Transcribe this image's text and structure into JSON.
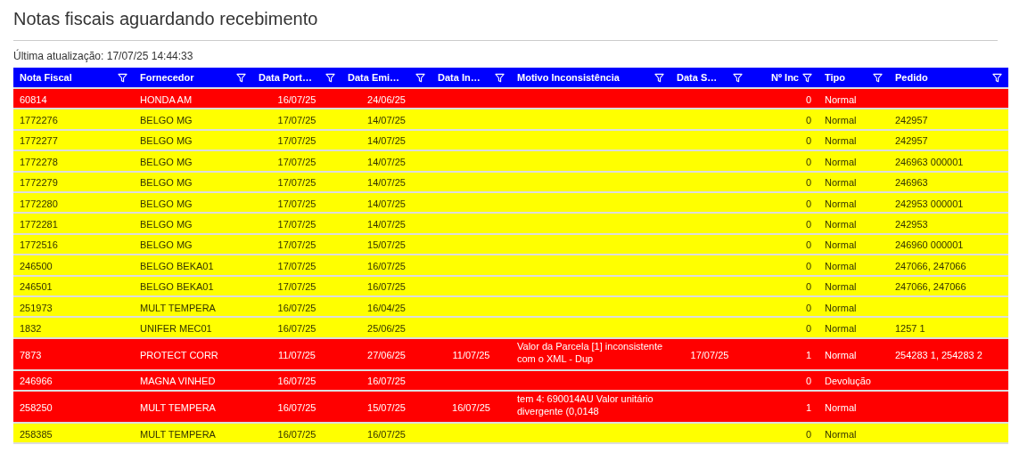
{
  "title": "Notas fiscais aguardando recebimento",
  "last_update": "Última atualização: 17/07/25 14:44:33",
  "table": {
    "columns": [
      "Nota Fiscal",
      "Fornecedor",
      "Data Port…",
      "Data Emi…",
      "Data In…",
      "Motivo Inconsistência",
      "Data S…",
      "Nº Inc",
      "Tipo",
      "Pedido"
    ],
    "rows": [
      {
        "color": "#ff0000",
        "nota_fiscal": "60814",
        "fornecedor": "HONDA AM",
        "data_port": "16/07/25",
        "data_emi": "24/06/25",
        "n_inc": "0",
        "tipo": "Normal"
      },
      {
        "color": "#ffff00",
        "nota_fiscal": "1772276",
        "fornecedor": "BELGO MG",
        "data_port": "17/07/25",
        "data_emi": "14/07/25",
        "n_inc": "0",
        "tipo": "Normal",
        "pedido": "242957"
      },
      {
        "color": "#ffff00",
        "nota_fiscal": "1772277",
        "fornecedor": "BELGO MG",
        "data_port": "17/07/25",
        "data_emi": "14/07/25",
        "n_inc": "0",
        "tipo": "Normal",
        "pedido": "242957"
      },
      {
        "color": "#ffff00",
        "nota_fiscal": "1772278",
        "fornecedor": "BELGO MG",
        "data_port": "17/07/25",
        "data_emi": "14/07/25",
        "n_inc": "0",
        "tipo": "Normal",
        "pedido": "246963 000001"
      },
      {
        "color": "#ffff00",
        "nota_fiscal": "1772279",
        "fornecedor": "BELGO MG",
        "data_port": "17/07/25",
        "data_emi": "14/07/25",
        "n_inc": "0",
        "tipo": "Normal",
        "pedido": "246963"
      },
      {
        "color": "#ffff00",
        "nota_fiscal": "1772280",
        "fornecedor": "BELGO MG",
        "data_port": "17/07/25",
        "data_emi": "14/07/25",
        "n_inc": "0",
        "tipo": "Normal",
        "pedido": "242953 000001"
      },
      {
        "color": "#ffff00",
        "nota_fiscal": "1772281",
        "fornecedor": "BELGO MG",
        "data_port": "17/07/25",
        "data_emi": "14/07/25",
        "n_inc": "0",
        "tipo": "Normal",
        "pedido": "242953"
      },
      {
        "color": "#ffff00",
        "nota_fiscal": "1772516",
        "fornecedor": "BELGO MG",
        "data_port": "17/07/25",
        "data_emi": "15/07/25",
        "n_inc": "0",
        "tipo": "Normal",
        "pedido": "246960 000001"
      },
      {
        "color": "#ffff00",
        "nota_fiscal": "246500",
        "fornecedor": "BELGO BEKA01",
        "data_port": "17/07/25",
        "data_emi": "16/07/25",
        "n_inc": "0",
        "tipo": "Normal",
        "pedido": "247066, 247066"
      },
      {
        "color": "#ffff00",
        "nota_fiscal": "246501",
        "fornecedor": "BELGO BEKA01",
        "data_port": "17/07/25",
        "data_emi": "16/07/25",
        "n_inc": "0",
        "tipo": "Normal",
        "pedido": "247066, 247066"
      },
      {
        "color": "#ffff00",
        "nota_fiscal": "251973",
        "fornecedor": "MULT TEMPERA",
        "data_port": "16/07/25",
        "data_emi": "16/04/25",
        "n_inc": "0",
        "tipo": "Normal"
      },
      {
        "color": "#ffff00",
        "nota_fiscal": "1832",
        "fornecedor": "UNIFER MEC01",
        "data_port": "16/07/25",
        "data_emi": "25/06/25",
        "n_inc": "0",
        "tipo": "Normal",
        "pedido": "1257 1"
      },
      {
        "color": "#ff0000",
        "nota_fiscal": "7873",
        "fornecedor": "PROTECT CORR",
        "data_port": "11/07/25",
        "data_emi": "27/06/25",
        "data_in": "11/07/25",
        "motivo": "Valor da Parcela [1] inconsistente com o XML - Dup",
        "data_s": "17/07/25",
        "n_inc": "1",
        "tipo": "Normal",
        "pedido": "254283 1, 254283 2"
      },
      {
        "color": "#ff0000",
        "nota_fiscal": "246966",
        "fornecedor": "MAGNA VINHED",
        "data_port": "16/07/25",
        "data_emi": "16/07/25",
        "n_inc": "0",
        "tipo": "Devolução"
      },
      {
        "color": "#ff0000",
        "nota_fiscal": "258250",
        "fornecedor": "MULT TEMPERA",
        "data_port": "16/07/25",
        "data_emi": "15/07/25",
        "data_in": "16/07/25",
        "motivo": "tem 4: 690014AU Valor unitário divergente (0,0148",
        "n_inc": "1",
        "tipo": "Normal"
      },
      {
        "color": "#ffff00",
        "nota_fiscal": "258385",
        "fornecedor": "MULT TEMPERA",
        "data_port": "16/07/25",
        "data_emi": "16/07/25",
        "n_inc": "0",
        "tipo": "Normal"
      }
    ]
  }
}
